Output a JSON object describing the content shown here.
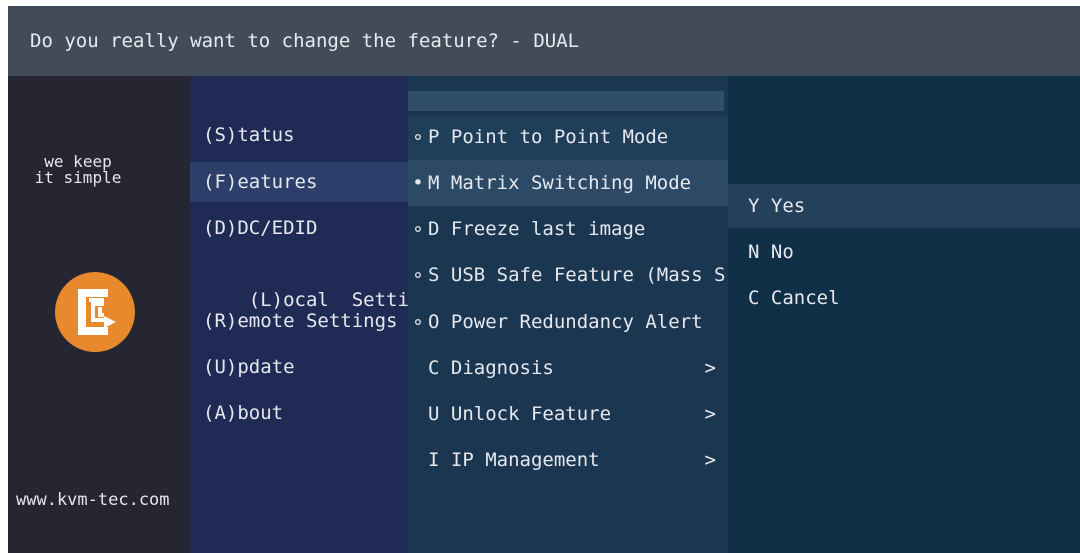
{
  "title": "Do you really want to change the feature? - DUAL",
  "logo_panel": {
    "tagline_line1": "we keep",
    "tagline_line2": "it simple",
    "logo_icon": "kvm-tec-logo-icon",
    "website": "www.kvm-tec.com"
  },
  "main_menu": [
    {
      "label": "(S)tatus"
    },
    {
      "label": "(F)eatures",
      "selected": true
    },
    {
      "label": "(D)DC/EDID"
    },
    {
      "label": "(L)ocal  Settings"
    },
    {
      "label": "(R)emote Settings"
    },
    {
      "label": "(U)pdate"
    },
    {
      "label": "(A)bout"
    }
  ],
  "features_menu": [
    {
      "bullet": "∘",
      "label": "P Point to Point Mode",
      "arrow": ""
    },
    {
      "bullet": "•",
      "label": "M Matrix Switching Mode",
      "arrow": ""
    },
    {
      "bullet": "∘",
      "label": "D Freeze last image",
      "arrow": ""
    },
    {
      "bullet": "∘",
      "label": "S USB Safe Feature (Mass S",
      "arrow": ""
    },
    {
      "bullet": "∘",
      "label": "O Power Redundancy Alert",
      "arrow": ""
    },
    {
      "bullet": "",
      "label": "C Diagnosis",
      "arrow": ">"
    },
    {
      "bullet": "",
      "label": "U Unlock Feature",
      "arrow": ">"
    },
    {
      "bullet": "",
      "label": "I IP Management",
      "arrow": ">"
    }
  ],
  "confirm_menu": [
    {
      "label": "Y Yes",
      "selected": true
    },
    {
      "label": "N No"
    },
    {
      "label": "C Cancel"
    }
  ],
  "colors": {
    "title_bar": "#414b5a",
    "logo_panel": "#252632",
    "main_menu_bg": "#1f2a55",
    "main_menu_selected": "#2b3f6a",
    "features_bg": "#1b3651",
    "features_highlight": "#2e4e6a",
    "confirm_bg": "#0f3047",
    "confirm_selected": "#24405a",
    "logo_orange": "#e8892e"
  }
}
